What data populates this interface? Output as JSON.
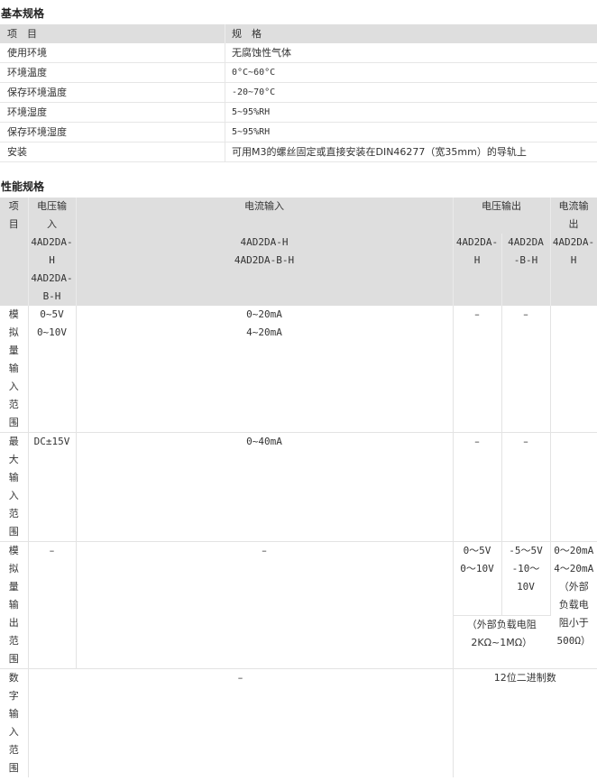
{
  "basic": {
    "title": "基本规格",
    "header": {
      "item": "项　目",
      "spec": "规　格"
    },
    "rows": [
      {
        "item": "使用环境",
        "spec": "无腐蚀性气体"
      },
      {
        "item": "环境温度",
        "spec": "0°C~60°C"
      },
      {
        "item": "保存环境温度",
        "spec": "-20~70°C"
      },
      {
        "item": "环境湿度",
        "spec": "5~95%RH"
      },
      {
        "item": "保存环境湿度",
        "spec": "5~95%RH"
      },
      {
        "item": "安装",
        "spec": "可用M3的螺丝固定或直接安装在DIN46277（宽35mm）的导轨上"
      }
    ]
  },
  "perf": {
    "title": "性能规格",
    "header": {
      "item": "项目",
      "voltage_in": "电压输入",
      "current_in": "电流输入",
      "voltage_out": "电压输出",
      "current_out": "电流输出"
    },
    "models": {
      "voltage_in_1": "4AD2DA-H",
      "voltage_in_2": "4AD2DA-B-H",
      "current_in_1": "4AD2DA-H",
      "current_in_2": "4AD2DA-B-H",
      "voltage_out_h": "4AD2DA-H",
      "voltage_out_bh": "4AD2DA-B-H",
      "current_out": "4AD2DA-H"
    },
    "analog_in": {
      "label": "模拟量输入范围",
      "voltage_1": "0~5V",
      "voltage_2": "0~10V",
      "current_1": "0~20mA",
      "current_2": "4~20mA",
      "vout_h": "–",
      "vout_bh": "–"
    },
    "max_in": {
      "label": "最大输入范围",
      "voltage": "DC±15V",
      "current": "0~40mA",
      "vout_h": "–",
      "vout_bh": "–"
    },
    "analog_out": {
      "label": "模拟量输出范围",
      "voltage": "–",
      "current": "–",
      "vout_h_1": "0～5V",
      "vout_h_2": "0～10V",
      "vout_bh_1": "-5～5V",
      "vout_bh_2": "-10～",
      "vout_bh_3": "10V",
      "load_1": "（外部负载电阻",
      "load_2": "2KΩ~1MΩ）",
      "iout_1": "0～20mA",
      "iout_2": "4～20mA",
      "iout_3": "（外部",
      "iout_4": "负载电",
      "iout_5": "阻小于",
      "iout_6": "500Ω）"
    },
    "digital_in": {
      "label": "数字输入范围",
      "value": "–",
      "output": "12位二进制数"
    }
  }
}
